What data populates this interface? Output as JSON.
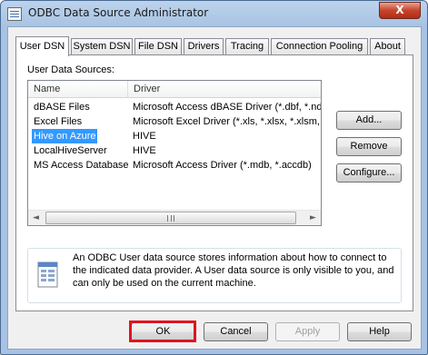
{
  "window": {
    "title": "ODBC Data Source Administrator",
    "close_label": "X"
  },
  "tabs": [
    {
      "label": "User DSN",
      "active": true
    },
    {
      "label": "System DSN"
    },
    {
      "label": "File DSN"
    },
    {
      "label": "Drivers"
    },
    {
      "label": "Tracing"
    },
    {
      "label": "Connection Pooling"
    },
    {
      "label": "About"
    }
  ],
  "panel": {
    "label": "User Data Sources:",
    "columns": {
      "name": "Name",
      "driver": "Driver"
    },
    "rows": [
      {
        "name": "dBASE Files",
        "driver": "Microsoft Access dBASE Driver (*.dbf, *.ndx"
      },
      {
        "name": "Excel Files",
        "driver": "Microsoft Excel Driver (*.xls, *.xlsx, *.xlsm, *.x"
      },
      {
        "name": "Hive on Azure",
        "driver": "HIVE",
        "selected": true
      },
      {
        "name": "LocalHiveServer",
        "driver": "HIVE"
      },
      {
        "name": "MS Access Database",
        "driver": "Microsoft Access Driver (*.mdb, *.accdb)"
      }
    ],
    "scroll_left": "◄",
    "scroll_right": "►",
    "buttons": {
      "add": "Add...",
      "remove": "Remove",
      "configure": "Configure..."
    },
    "info_text": "An ODBC User data source stores information about how to connect to the indicated data provider.   A User data source is only visible to you, and can only be used on the current machine."
  },
  "footer": {
    "ok": "OK",
    "cancel": "Cancel",
    "apply": "Apply",
    "help": "Help"
  },
  "colors": {
    "selection": "#3399ff",
    "highlight_border": "#e0141e"
  }
}
